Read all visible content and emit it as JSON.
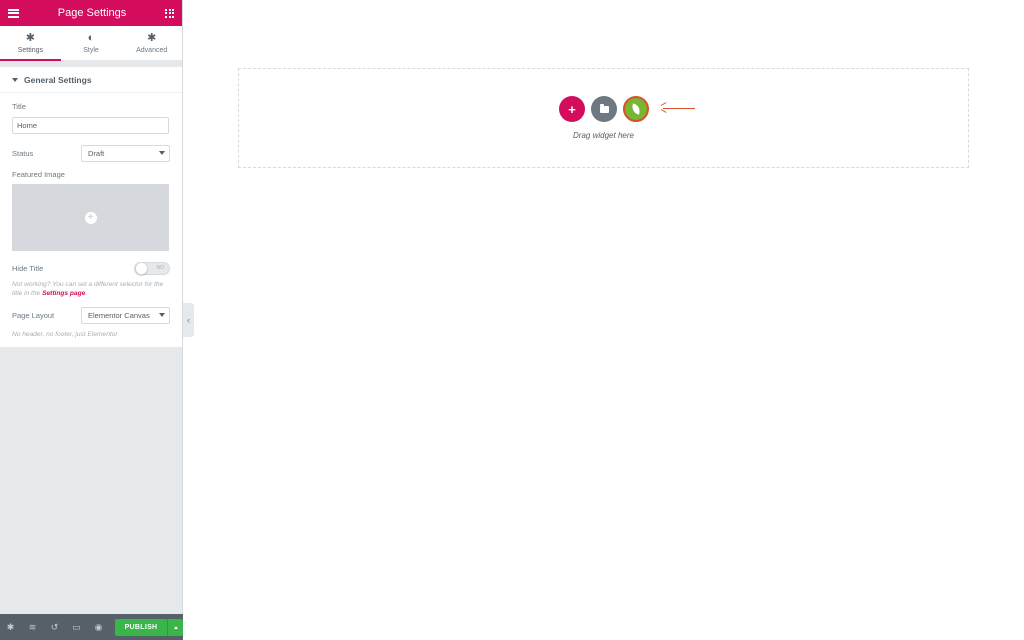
{
  "panel": {
    "title": "Page Settings",
    "tabs": [
      {
        "label": "Settings",
        "icon": "gear-icon",
        "active": true
      },
      {
        "label": "Style",
        "icon": "contrast-icon",
        "active": false
      },
      {
        "label": "Advanced",
        "icon": "gear-icon",
        "active": false
      }
    ],
    "section": {
      "title": "General Settings"
    },
    "fields": {
      "title": {
        "label": "Title",
        "value": "Home"
      },
      "status": {
        "label": "Status",
        "value": "Draft"
      },
      "featured_image": {
        "label": "Featured Image"
      },
      "hide_title": {
        "label": "Hide Title",
        "state": "NO",
        "enabled": false,
        "note_text": "Not working? You can set a different selector for the title in the ",
        "note_link": "Settings page",
        "note_end": "."
      },
      "page_layout": {
        "label": "Page Layout",
        "value": "Elementor Canvas",
        "note": "No header, no footer, just Elementor"
      }
    },
    "footer": {
      "icons": [
        "settings-icon",
        "layers-icon",
        "history-icon",
        "responsive-icon",
        "preview-icon"
      ],
      "publish_label": "PUBLISH"
    }
  },
  "canvas": {
    "drop_hint": "Drag widget here",
    "buttons": [
      "add-section-button",
      "template-library-button",
      "envato-kits-button"
    ]
  },
  "colors": {
    "accent": "#d30c5c",
    "publish": "#39b54a",
    "envato_green": "#79b432",
    "annotation": "#d9512c"
  }
}
